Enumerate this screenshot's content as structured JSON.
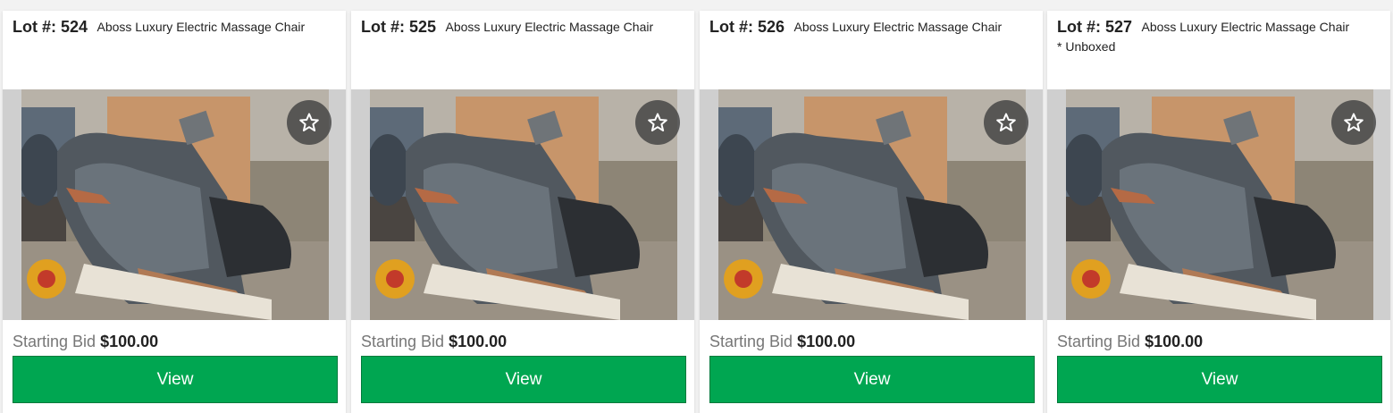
{
  "colors": {
    "page_background": "#f2f2f2",
    "button_green": "#00a651",
    "favorite_badge": "#3c3c3c"
  },
  "lots": [
    {
      "lot_label": "Lot #: 524",
      "title": "Aboss Luxury Electric Massage Chair",
      "note": "",
      "starting_bid_label": "Starting Bid",
      "starting_bid": "$100.00",
      "view_label": "View",
      "favorite_icon": "star-outline-icon"
    },
    {
      "lot_label": "Lot #: 525",
      "title": "Aboss Luxury Electric Massage Chair",
      "note": "",
      "starting_bid_label": "Starting Bid",
      "starting_bid": "$100.00",
      "view_label": "View",
      "favorite_icon": "star-outline-icon"
    },
    {
      "lot_label": "Lot #: 526",
      "title": "Aboss Luxury Electric Massage Chair",
      "note": "",
      "starting_bid_label": "Starting Bid",
      "starting_bid": "$100.00",
      "view_label": "View",
      "favorite_icon": "star-outline-icon"
    },
    {
      "lot_label": "Lot #: 527",
      "title": "Aboss Luxury Electric Massage Chair",
      "note": "* Unboxed",
      "starting_bid_label": "Starting Bid",
      "starting_bid": "$100.00",
      "view_label": "View",
      "favorite_icon": "star-outline-icon"
    }
  ]
}
